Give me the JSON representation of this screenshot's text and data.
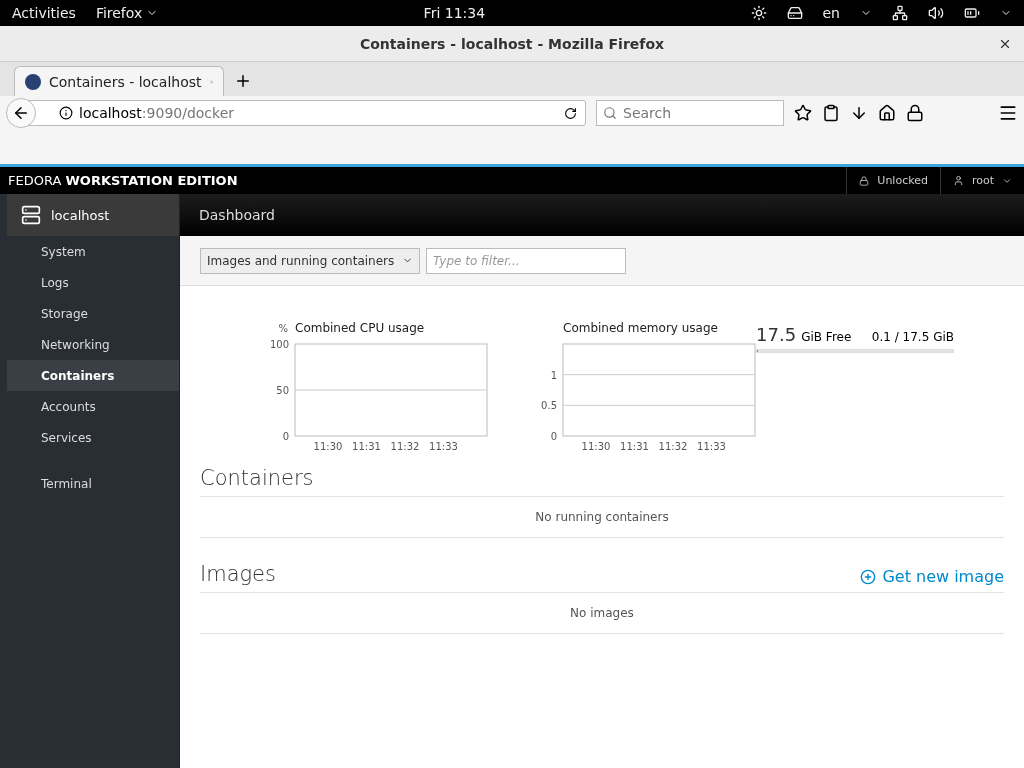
{
  "top_bar": {
    "activities": "Activities",
    "app": "Firefox",
    "clock": "Fri 11:34",
    "language": "en"
  },
  "window": {
    "title": "Containers - localhost - Mozilla Firefox"
  },
  "tabs": [
    {
      "label": "Containers - localhost",
      "selected": true
    }
  ],
  "address_bar": {
    "host": "localhost",
    "path": ":9090/docker"
  },
  "search": {
    "placeholder": "Search"
  },
  "cockpit": {
    "brand_light": "FEDORA",
    "brand_bold": "WORKSTATION EDITION",
    "lock": "Unlocked",
    "user": "root"
  },
  "sidebar": {
    "host": "localhost",
    "items": [
      {
        "label": "System",
        "selected": false
      },
      {
        "label": "Logs",
        "selected": false
      },
      {
        "label": "Storage",
        "selected": false
      },
      {
        "label": "Networking",
        "selected": false
      },
      {
        "label": "Containers",
        "selected": true
      },
      {
        "label": "Accounts",
        "selected": false
      },
      {
        "label": "Services",
        "selected": false
      },
      {
        "label": "Terminal",
        "selected": false
      }
    ]
  },
  "breadcrumb": "Dashboard",
  "toolbar": {
    "dropdown": "Images and running containers",
    "filter_placeholder": "Type to filter..."
  },
  "charts": [
    {
      "unit": "%",
      "chart_data": {
        "type": "line",
        "title": "Combined CPU usage",
        "ylim": [
          0,
          100
        ],
        "yticks": [
          0,
          50,
          100
        ],
        "categories": [
          "11:30",
          "11:31",
          "11:32",
          "11:33"
        ]
      }
    },
    {
      "chart_data": {
        "type": "line",
        "title": "Combined memory usage",
        "ylim": [
          0,
          1.5
        ],
        "yticks": [
          0,
          0.5,
          1
        ],
        "categories": [
          "11:30",
          "11:31",
          "11:32",
          "11:33"
        ]
      }
    }
  ],
  "memory": {
    "free": "17.5",
    "free_unit": "GiB Free",
    "usage": "0.1 / 17.5 GiB",
    "level": 0.006
  },
  "containers": {
    "title": "Containers",
    "empty": "No running containers"
  },
  "images": {
    "title": "Images",
    "action": "Get new image",
    "empty": "No images"
  }
}
